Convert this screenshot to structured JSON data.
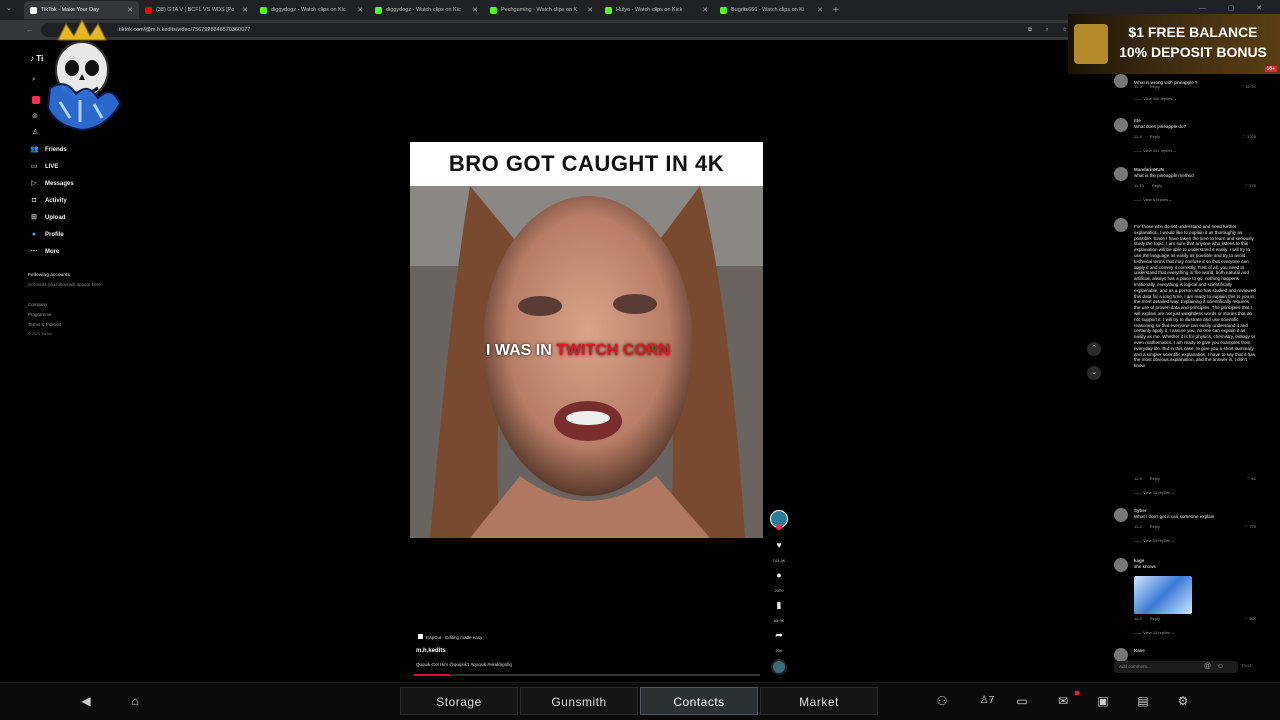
{
  "browser": {
    "tabs": [
      {
        "label": "TikTok - Make Your Day",
        "color": "#ffffff",
        "active": true
      },
      {
        "label": "(38) GTA V | BCFL VS WDS [Po",
        "color": "#ff0000"
      },
      {
        "label": "diggydogz - Watch clips on Kic",
        "color": "#53fc18"
      },
      {
        "label": "diggydogz - Watch clips on Kic",
        "color": "#53fc18"
      },
      {
        "label": "Pechgaming - Watch clips on K",
        "color": "#53fc18"
      },
      {
        "label": "Hulyo - Watch clips on Kick",
        "color": "#53fc18"
      },
      {
        "label": "Bugrits666 - Watch clips on Ki",
        "color": "#53fc18"
      }
    ],
    "new_tab": "+",
    "url": "tiktok.com/@m.h.kedits/video/7567928846570360077"
  },
  "sidebar": {
    "items": [
      {
        "label": "Friends",
        "icon": "friends-icon",
        "glyph": "👥"
      },
      {
        "label": "LIVE",
        "icon": "live-icon",
        "glyph": "▭"
      },
      {
        "label": "Messages",
        "icon": "messages-icon",
        "glyph": "▷"
      },
      {
        "label": "Activity",
        "icon": "activity-icon",
        "glyph": "◘"
      },
      {
        "label": "Upload",
        "icon": "upload-icon",
        "glyph": "⊞"
      },
      {
        "label": "Profile",
        "icon": "profile-icon",
        "glyph": "●"
      },
      {
        "label": "More",
        "icon": "more-icon",
        "glyph": "⋯"
      }
    ],
    "following_title": "Following accounts",
    "following_sub": "Accounts you follow will appear here",
    "footer": [
      "Company",
      "Programme",
      "Terms & Policies",
      "© 2025 TikTok"
    ]
  },
  "video": {
    "title": "BRO GOT CAUGHT IN 4K",
    "caption_white": "I WAS IN ",
    "caption_red": "TWITCH CORN",
    "capcut": "CapCut · Editing made easy",
    "username": "m.h.kedits",
    "description": "Qoquik Got Him @qoqsik1 #qoqsik #viralclipsfig",
    "progress": 0.1
  },
  "rail": {
    "likes": "743.4K",
    "comments": "2070",
    "saves": "63.9K",
    "shares": "20K"
  },
  "comments": [
    {
      "user": "",
      "text": "What is wrong with pineapple ?",
      "date": "11-3",
      "likes": "31.7K",
      "replies": "View 196 replies"
    },
    {
      "user": "itte",
      "text": "What does pineapple do?",
      "date": "11-6",
      "likes": "3225",
      "replies": "View 131 replies"
    },
    {
      "user": "MandarinHUN",
      "text": "what is the pineapple method",
      "date": "11-13",
      "likes": "575",
      "replies": "View 6 replies"
    },
    {
      "user": "",
      "text": "For those who do not understand and need further explanation, I would like to explain it as thoroughly as possible. Since I have taken the time to learn and seriously study the topic, I am sure that anyone who listens to this explanation will be able to understand it easily. I will try to use the language as easily as possible and try to avoid technical terms that may confuse it so that everyone can apply it and convey it correctly. First of all, you need to understand that everything in the world, both natural and artificial, always has a place to go, nothing happens irrationally, everything is logical and scientifically explainable, and as a person who has studied and reviewed this data for a long time, I am ready to explain this to you in the most detailed way. Explaining it scientifically requires the use of proven data and principles. The principles that I will explain are not just weightless words or stories that do not support it. I will try to illustrate and use scientific reasoning so that everyone can easily understand it and certainly apply it. I assure you, no one can explain it as easily as me. Whether it is for physics, chemistry, biology or even mathematics, I am ready to give you examples from everyday life. But in this case, to give you a short summary and a simpler scientific explanation, I have to say that it has the most obvious explanation, and the answer is, I don't know.",
      "date": "11-9",
      "likes": "61",
      "replies": "View 12 replies"
    },
    {
      "user": "Syber",
      "text": "What I don't get it can someone explain",
      "date": "11-2",
      "likes": "779",
      "replies": "View 31 replies"
    },
    {
      "user": "kage",
      "text": "she knows",
      "date": "11-3",
      "likes": "46K",
      "replies": "View 12 replies"
    },
    {
      "user": "Kase",
      "text": "",
      "date": "",
      "likes": "",
      "replies": ""
    }
  ],
  "comment_ui": {
    "reply_label": "Reply",
    "input_placeholder": "Add comment...",
    "post_label": "Post"
  },
  "ad": {
    "line1": "$1 FREE BALANCE",
    "line2": "10% DEPOSIT BONUS",
    "age": "18+"
  },
  "gamebar": {
    "buttons": [
      "Storage",
      "Gunsmith",
      "Contacts",
      "Market"
    ],
    "active": "Contacts",
    "right_count": "7"
  }
}
